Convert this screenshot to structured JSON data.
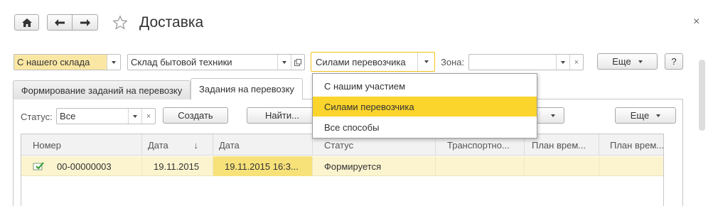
{
  "window": {
    "title": "Доставка",
    "close_glyph": "×"
  },
  "filters": {
    "source": "С нашего склада",
    "warehouse": "Склад бытовой техники",
    "method": "Силами перевозчика",
    "zone_label": "Зона:",
    "zone_value": "",
    "more_label": "Еще",
    "help_label": "?"
  },
  "tabs": [
    {
      "label": "Формирование заданий на перевозку"
    },
    {
      "label": "Задания на перевозку"
    }
  ],
  "list_toolbar": {
    "status_label": "Статус:",
    "status_value": "Все",
    "create_label": "Создать",
    "find_label": "Найти...",
    "more_label": "Еще"
  },
  "table": {
    "columns": [
      "Номер",
      "Дата",
      "Дата",
      "Статус",
      "Транспортно...",
      "План врем...",
      "План врем..."
    ],
    "sort_indicator": "↓",
    "rows": [
      {
        "number": "00-00000003",
        "date": "19.11.2015",
        "date2": "19.11.2015 16:3...",
        "status": "Формируется",
        "transport": "",
        "plan1": "",
        "plan2": ""
      }
    ]
  },
  "dropdown": {
    "options": [
      "С нашим участием",
      "Силами перевозчика",
      "Все способы"
    ],
    "selected_index": 1
  },
  "colors": {
    "accent": "#fbd42c",
    "source_field": "#fbe7a4",
    "row_highlight": "#fbf4cf"
  }
}
